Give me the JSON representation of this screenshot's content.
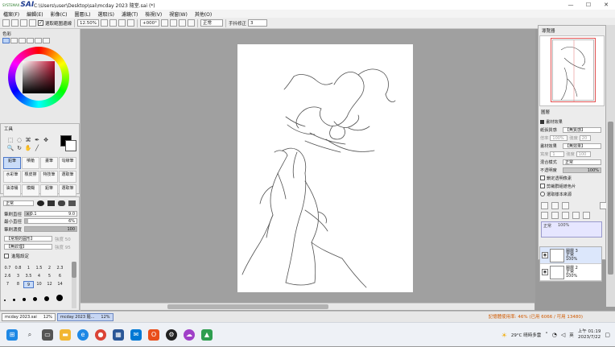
{
  "title_bar": {
    "app_logo": "SAI",
    "maker": "SYSTEMAX",
    "window_title": "C:\\Users\\user\\Desktop\\sai\\mcday 2023 隨堂.sai (*)",
    "minimize": "—",
    "maximize": "☐",
    "close": "✕"
  },
  "menu": [
    "檔案(F)",
    "編輯(E)",
    "影像(C)",
    "圖層(L)",
    "選取(S)",
    "濾鏡(T)",
    "檢視(V)",
    "視窗(W)",
    "其他(O)"
  ],
  "toolbar": {
    "selection_check": "✓",
    "selection_label": "選取範圍邊線",
    "zoom": "12.50%",
    "angle": "+000°",
    "blend": "正常",
    "stabilizer_label": "手抖修正",
    "stabilizer_value": "3"
  },
  "left_panel": {
    "color_label": "色彩",
    "tools_label": "工具",
    "tool_icons": [
      "⬚",
      "◌",
      "⌘",
      "✒",
      "■",
      "✥",
      "🔍",
      "↻",
      "✋",
      "╱"
    ],
    "tools": [
      "鉛筆",
      "噴槍",
      "畫筆",
      "勾線筆",
      "水彩筆",
      "橡皮擦",
      "特技筆",
      "選取筆",
      "油漆桶",
      "模糊",
      "鉛筆",
      "選取筆"
    ],
    "blend_mode": "正常",
    "brush_size_label": "筆刷直徑",
    "brush_size_mult": "x 0.1",
    "brush_size_value": "9.0",
    "min_size_label": "最小直徑",
    "min_size_value": "6%",
    "density_label": "筆刷濃度",
    "density_value": "100",
    "shape_option": "【常規的圓形】",
    "shape_strength": "強度 50",
    "texture_option": "【無紋理】",
    "texture_strength": "強度 95",
    "advanced_label": "進階設定",
    "sizes": [
      "0.7",
      "0.8",
      "1",
      "1.5",
      "2",
      "2.3",
      "2.6",
      "3",
      "3.5",
      "4",
      "5",
      "6",
      "7",
      "8",
      "9",
      "10",
      "12",
      "14",
      "16",
      "20"
    ]
  },
  "navigator": {
    "label": "導覽器"
  },
  "layer_panel": {
    "label": "圖層",
    "paper_effect_label": "畫材效果",
    "paper_texture_label": "紙張質感",
    "paper_texture_value": "【無質感】",
    "paper_scale": "倍率",
    "paper_scale_value": "100%",
    "paper_strength": "強度",
    "paper_strength_value": "20",
    "brush_effect_label": "畫材效果",
    "brush_effect_value": "【無效果】",
    "brush_width_label": "寬度",
    "brush_width_value": "1",
    "brush_strength_label": "強度",
    "brush_strength_value": "100",
    "blend_label": "混合模式",
    "blend_value": "正常",
    "opacity_label": "不透明度",
    "opacity_value": "100%",
    "check_lock": "鎖定透明像素",
    "check_clip": "剪裁群組遮色片",
    "check_source": "選取樣本來源",
    "normal_label": "正常",
    "normal_value": "100%",
    "layers": [
      {
        "name": "圖層 3",
        "mode": "正常",
        "opacity": "100%"
      },
      {
        "name": "圖層 2",
        "mode": "正常",
        "opacity": "100%"
      }
    ]
  },
  "status": {
    "tabs": [
      {
        "name": "mcday 2023.sai",
        "zoom": "12%"
      },
      {
        "name": "mcday 2023 隨...",
        "zoom": "12%"
      }
    ],
    "memory": "記憶體使用率: 46% (已用 6066 / 可用 13480)"
  },
  "taskbar": {
    "weather": "29°C 晴時多雲",
    "ime": "英",
    "time": "上午 01:19",
    "date": "2023/7/22",
    "icons": [
      "windows",
      "search",
      "task-view",
      "file-explorer",
      "edge",
      "chrome",
      "store",
      "mail",
      "office",
      "steam",
      "messenger",
      "photos"
    ]
  }
}
